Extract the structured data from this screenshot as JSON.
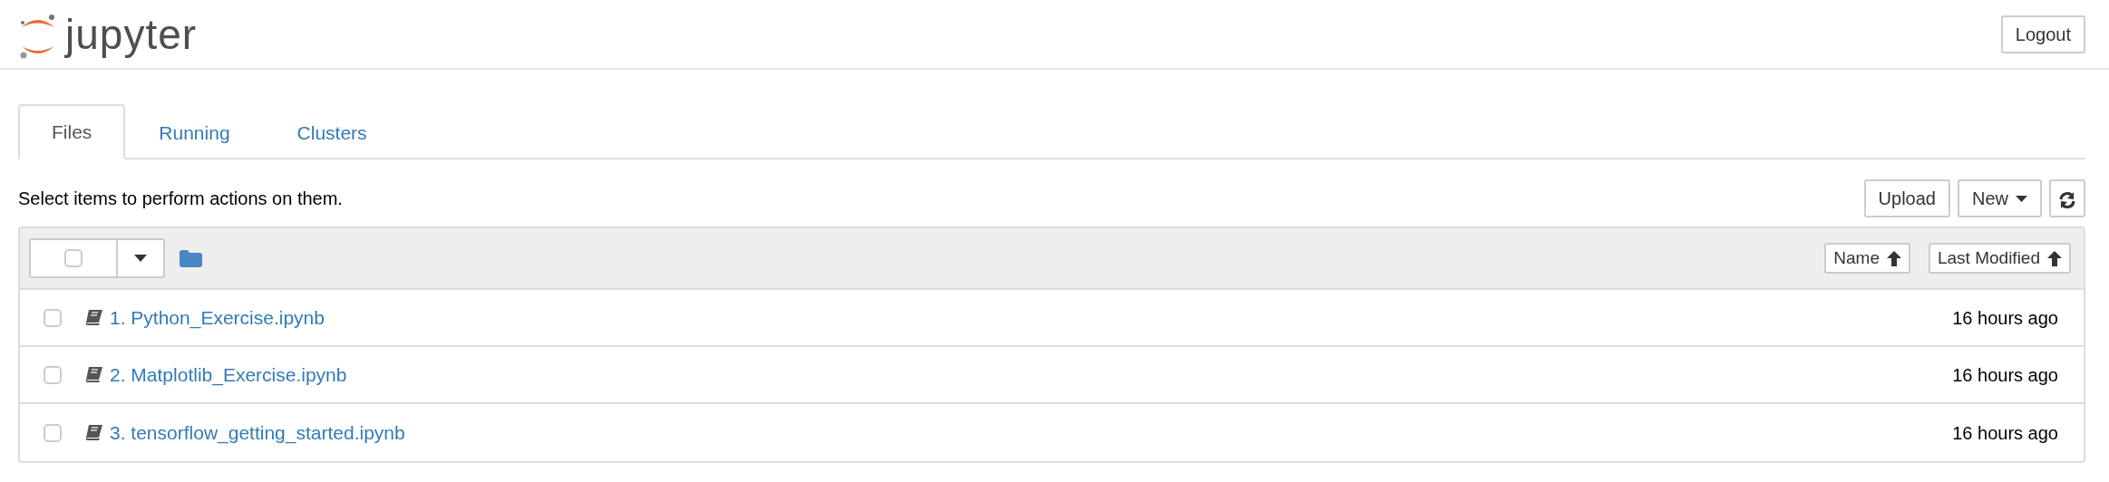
{
  "header": {
    "logo_text": "jupyter",
    "logout": "Logout"
  },
  "tabs": [
    {
      "label": "Files",
      "selected": true
    },
    {
      "label": "Running",
      "selected": false
    },
    {
      "label": "Clusters",
      "selected": false
    }
  ],
  "toolbar": {
    "hint": "Select items to perform actions on them.",
    "upload": "Upload",
    "new": "New"
  },
  "list_header": {
    "select_all_checked": false,
    "sort_buttons": [
      "Name",
      "Last Modified"
    ]
  },
  "files": [
    {
      "name": "1. Python_Exercise.ipynb",
      "modified": "16 hours ago",
      "checked": false
    },
    {
      "name": "2. Matplotlib_Exercise.ipynb",
      "modified": "16 hours ago",
      "checked": false
    },
    {
      "name": "3. tensorflow_getting_started.ipynb",
      "modified": "16 hours ago",
      "checked": false
    }
  ]
}
